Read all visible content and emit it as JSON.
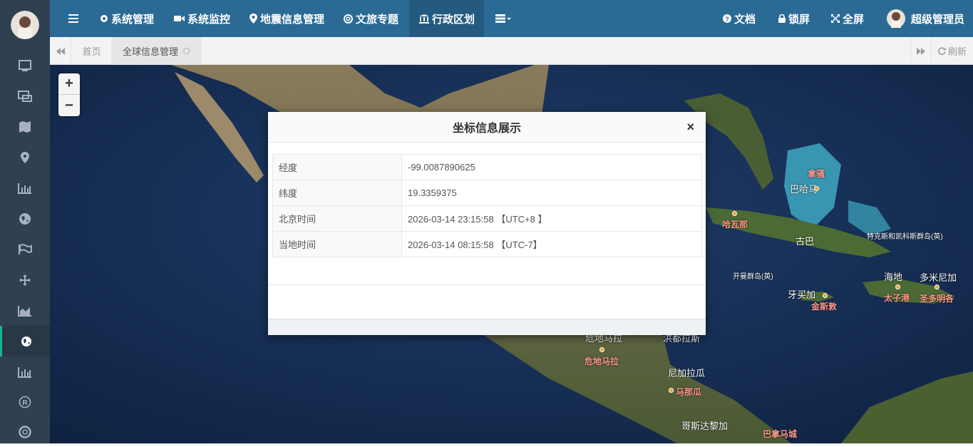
{
  "topnav": {
    "items": [
      {
        "label": "系统管理"
      },
      {
        "label": "系统监控"
      },
      {
        "label": "地震信息管理"
      },
      {
        "label": "文旅专题"
      },
      {
        "label": "行政区划"
      }
    ],
    "right": {
      "docs": "文档",
      "lock": "锁屏",
      "fullscreen": "全屏",
      "user": "超级管理员"
    }
  },
  "tabs": {
    "home": "首页",
    "active": "全球信息管理",
    "refresh": "刷新"
  },
  "map": {
    "zoom_in": "+",
    "zoom_out": "−",
    "labels": {
      "bahamas": "巴哈马",
      "nassau": "拿骚",
      "havana": "哈瓦那",
      "cuba": "古巴",
      "turks": "特克斯和凯科斯群岛(英)",
      "cayman": "开曼群岛(英)",
      "haiti": "海地",
      "dominican": "多米尼加",
      "portauprince": "太子港",
      "santodomingo": "圣多明各",
      "jamaica": "牙买加",
      "kingston": "金斯敦",
      "guatemala": "危地马拉",
      "guatemala_city": "危地马拉",
      "honduras": "洪都拉斯",
      "nicaragua": "尼加拉瓜",
      "managua": "马那瓜",
      "costarica": "哥斯达黎加",
      "panama": "巴拿马城"
    }
  },
  "modal": {
    "title": "坐标信息展示",
    "close": "×",
    "rows": [
      {
        "key": "经度",
        "value": "-99.0087890625"
      },
      {
        "key": "纬度",
        "value": "19.3359375"
      },
      {
        "key": "北京时间",
        "value": "2026-03-14 23:15:58 【UTC+8 】"
      },
      {
        "key": "当地时间",
        "value": "2026-03-14 08:15:58 【UTC-7】"
      }
    ]
  }
}
